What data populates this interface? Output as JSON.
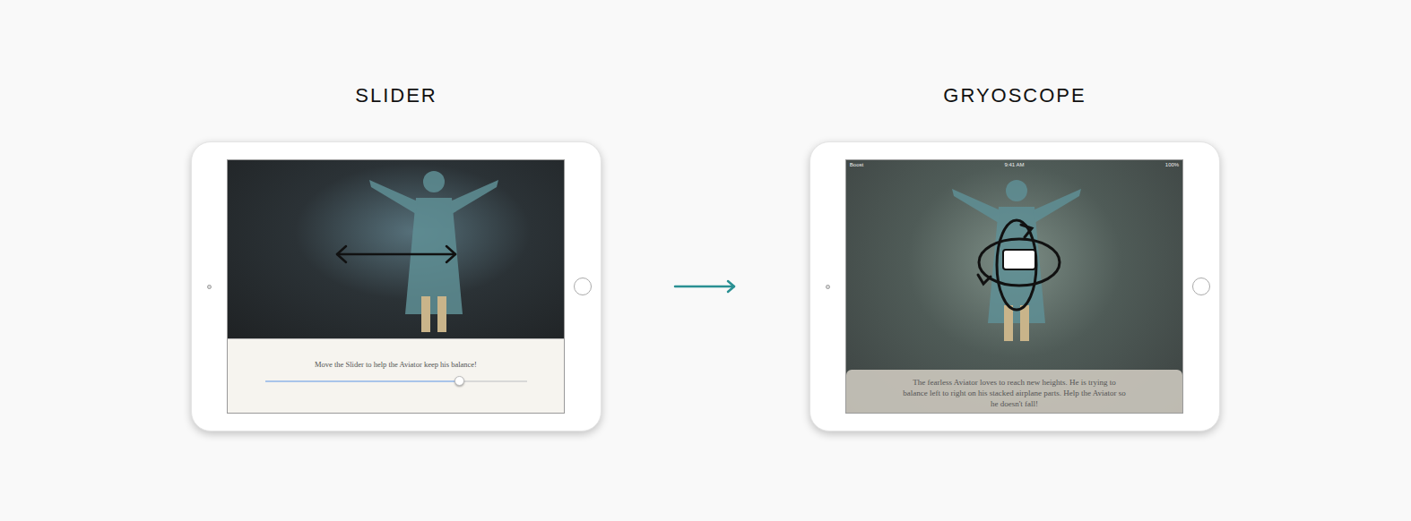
{
  "devices": [
    {
      "title": "SLIDER",
      "kind": "slider",
      "prompt": "Move the Slider to help the Aviator keep his balance!",
      "level": 0.74
    },
    {
      "title": "GRYOSCOPE",
      "kind": "gyroscope",
      "status_bar": {
        "carrier": "Boost",
        "time": "9:41 AM",
        "battery": "100%"
      },
      "caption": "The fearless Aviator loves to reach new heights. He is trying to balance left to right on his stacked airplane parts. Help the Aviator so he doesn't fall!"
    }
  ]
}
